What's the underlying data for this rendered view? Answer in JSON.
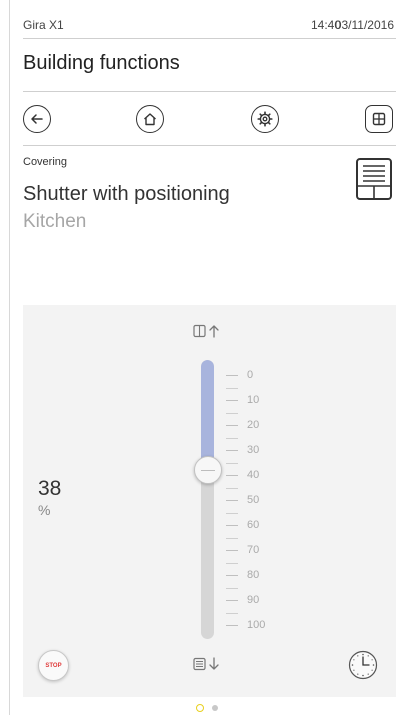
{
  "status_bar": {
    "device_name": "Gira X1",
    "time": "14:40",
    "date": "03/11/2016"
  },
  "header": {
    "title": "Building functions"
  },
  "nav": {
    "buttons": [
      {
        "name": "back",
        "icon": "arrow-left-icon"
      },
      {
        "name": "home",
        "icon": "home-icon"
      },
      {
        "name": "settings",
        "icon": "gear-icon"
      },
      {
        "name": "grid",
        "icon": "grid-icon"
      }
    ]
  },
  "function": {
    "category": "Covering",
    "title": "Shutter with positioning",
    "room": "Kitchen",
    "type_icon": "shutter-icon"
  },
  "control": {
    "value": "38",
    "unit": "%",
    "position_fraction": 0.38,
    "scale_labels": [
      "0",
      "10",
      "20",
      "30",
      "40",
      "50",
      "60",
      "70",
      "80",
      "90",
      "100"
    ],
    "up_icon": "shutter-up-icon",
    "down_icon": "shutter-down-icon",
    "stop_label": "STOP",
    "timer_icon": "clock-icon",
    "colors": {
      "fill": "#a8b4dd",
      "track": "#d6d6d6",
      "stop": "#e03a3a"
    }
  },
  "pager": {
    "pages": 2,
    "active_index": 0,
    "active_color": "#e8d01f"
  }
}
